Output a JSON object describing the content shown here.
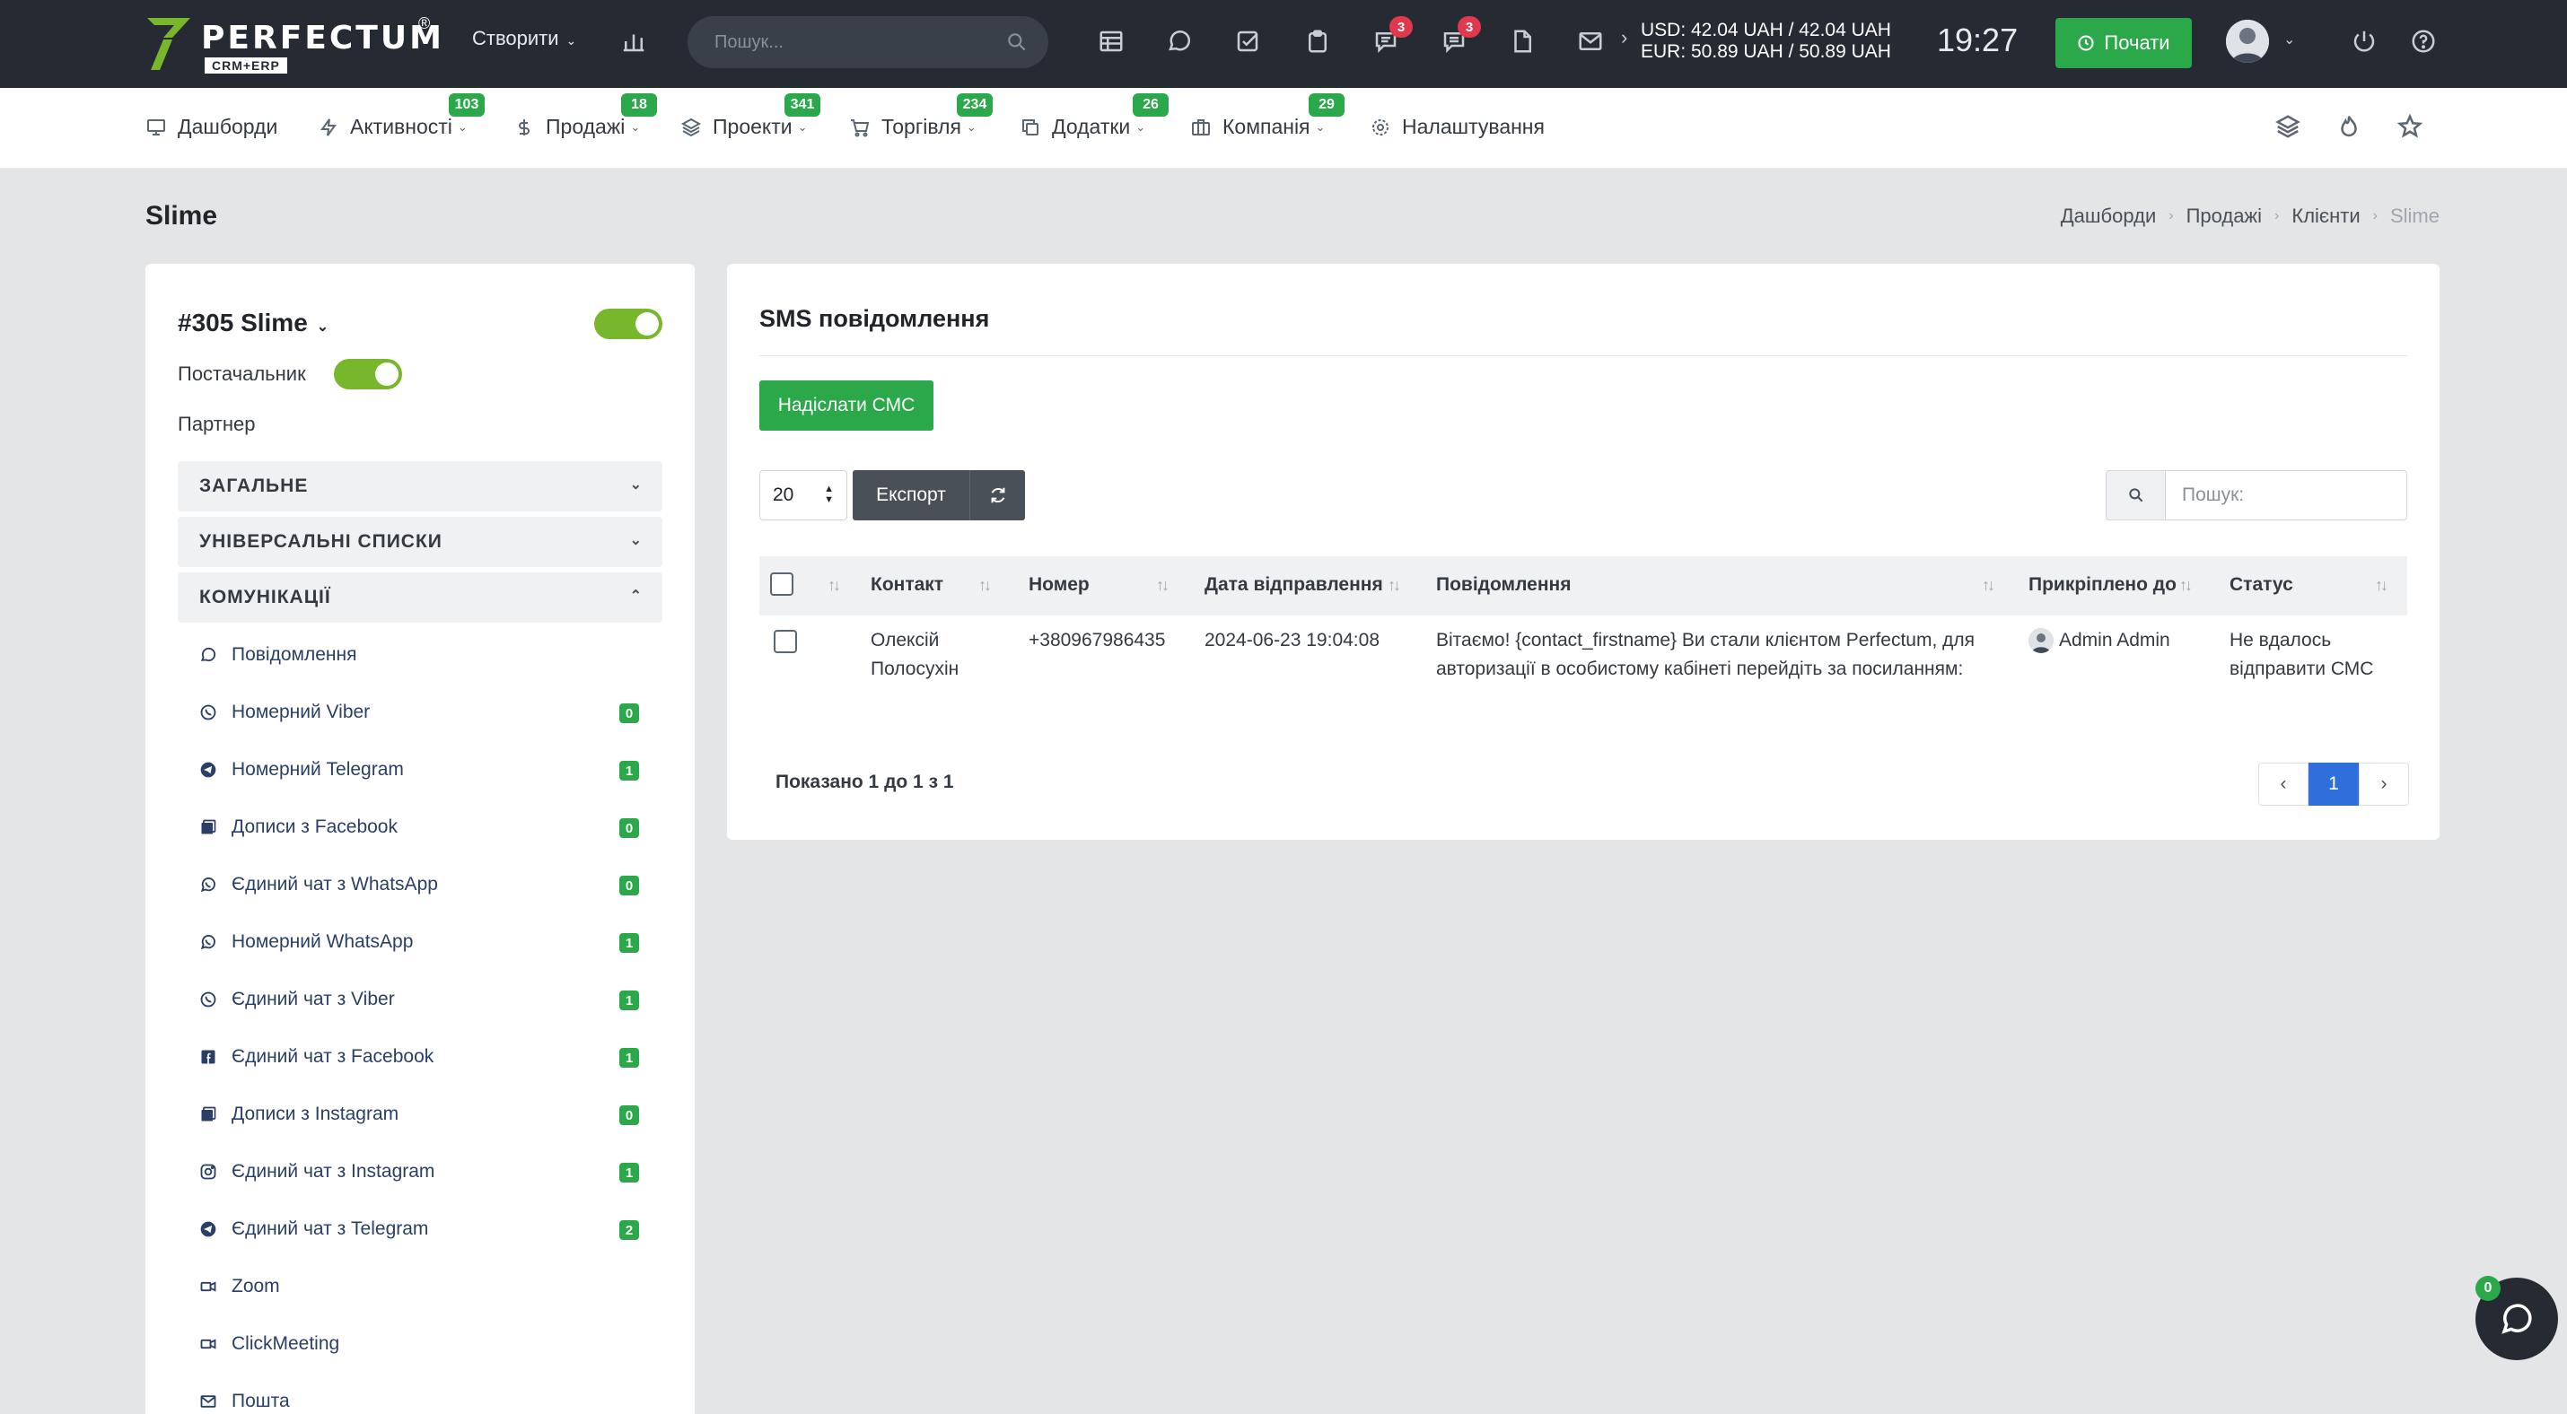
{
  "topbar": {
    "logo_text": "PERFECTUM",
    "logo_reg": "®",
    "logo_sub": "CRM+ERP",
    "create_label": "Створити",
    "search_placeholder": "Пошук...",
    "chat_badge": "3",
    "messages_badge": "3",
    "usd_rate": "USD: 42.04 UAH / 42.04 UAH",
    "eur_rate": "EUR: 50.89 UAH / 50.89 UAH",
    "time": "19:27",
    "start_label": "Почати"
  },
  "nav": {
    "items": [
      {
        "label": "Дашборди",
        "badge": ""
      },
      {
        "label": "Активності",
        "badge": "103"
      },
      {
        "label": "Продажі",
        "badge": "18"
      },
      {
        "label": "Проекти",
        "badge": "341"
      },
      {
        "label": "Торгівля",
        "badge": "234"
      },
      {
        "label": "Додатки",
        "badge": "26"
      },
      {
        "label": "Компанія",
        "badge": "29"
      },
      {
        "label": "Налаштування",
        "badge": ""
      }
    ]
  },
  "page": {
    "title": "Slime",
    "breadcrumb": [
      "Дашборди",
      "Продажі",
      "Клієнти",
      "Slime"
    ]
  },
  "client": {
    "name": "#305 Slime",
    "supplier_label": "Постачальник",
    "partner_label": "Партнер",
    "sections": [
      "ЗАГАЛЬНЕ",
      "УНІВЕРСАЛЬНІ СПИСКИ",
      "КОМУНІКАЦІЇ"
    ],
    "comm_items": [
      {
        "label": "Повідомлення",
        "icon": "chat-bubble-icon",
        "count": ""
      },
      {
        "label": "Номерний Viber",
        "icon": "viber-icon",
        "count": "0"
      },
      {
        "label": "Номерний Telegram",
        "icon": "telegram-icon",
        "count": "1"
      },
      {
        "label": "Дописи з Facebook",
        "icon": "posts-icon",
        "count": "0"
      },
      {
        "label": "Єдиний чат з WhatsApp",
        "icon": "whatsapp-icon",
        "count": "0"
      },
      {
        "label": "Номерний WhatsApp",
        "icon": "whatsapp-icon",
        "count": "1"
      },
      {
        "label": "Єдиний чат з Viber",
        "icon": "viber-icon",
        "count": "1"
      },
      {
        "label": "Єдиний чат з Facebook",
        "icon": "facebook-icon",
        "count": "1"
      },
      {
        "label": "Дописи з Instagram",
        "icon": "posts-icon",
        "count": "0"
      },
      {
        "label": "Єдиний чат з Instagram",
        "icon": "instagram-icon",
        "count": "1"
      },
      {
        "label": "Єдиний чат з Telegram",
        "icon": "telegram-icon",
        "count": "2"
      },
      {
        "label": "Zoom",
        "icon": "video-icon",
        "count": ""
      },
      {
        "label": "ClickMeeting",
        "icon": "video-icon",
        "count": ""
      },
      {
        "label": "Пошта",
        "icon": "mail-icon",
        "count": ""
      }
    ]
  },
  "sms": {
    "title": "SMS повідомлення",
    "send_label": "Надіслати СМС",
    "page_size": "20",
    "export_label": "Експорт",
    "search_placeholder": "Пошук:",
    "columns": [
      "Контакт",
      "Номер",
      "Дата відправлення",
      "Повідомлення",
      "Прикріплено до",
      "Статус"
    ],
    "rows": [
      {
        "contact_line1": "Олексій",
        "contact_line2": "Полосухін",
        "number": "+380967986435",
        "date": "2024-06-23 19:04:08",
        "message_line1": "Вітаємо! {contact_firstname} Ви стали клієнтом Perfectum, для",
        "message_line2": "авторизації в особистому кабінеті перейдіть за посиланням:",
        "attached_to": "Admin Admin",
        "status_line1": "Не вдалось",
        "status_line2": "відправити СМС"
      }
    ],
    "shown_text": "Показано 1 до 1 з 1",
    "pager": {
      "prev": "‹",
      "current": "1",
      "next": "›"
    }
  },
  "chat_widget": {
    "badge": "0"
  },
  "colors": {
    "accent_green": "#2aa84a",
    "topbar_bg": "#262b33",
    "badge_red": "#e0384d",
    "toggle_on": "#78b62b",
    "pager_active": "#2f6fdb"
  }
}
